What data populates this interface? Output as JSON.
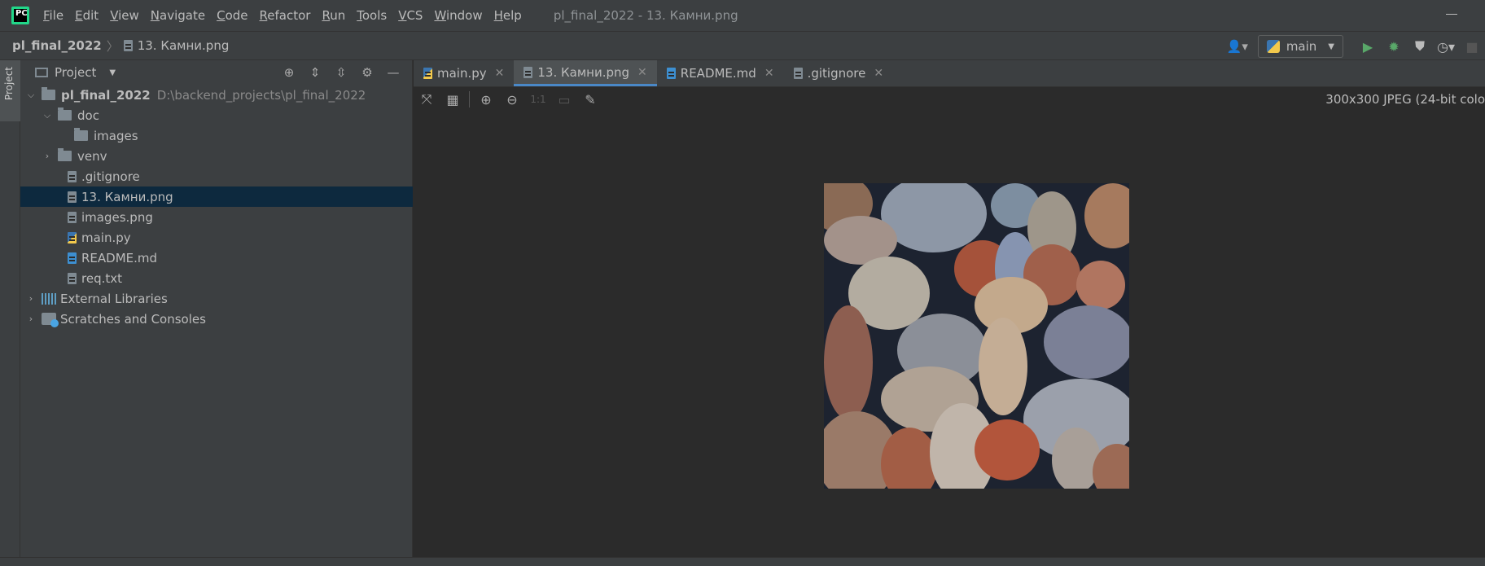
{
  "app": {
    "logo": "pycharm-logo",
    "logo_text": "PC",
    "window_title": "pl_final_2022 - 13. Камни.png"
  },
  "menu": [
    "File",
    "Edit",
    "View",
    "Navigate",
    "Code",
    "Refactor",
    "Run",
    "Tools",
    "VCS",
    "Window",
    "Help"
  ],
  "breadcrumb": {
    "project": "pl_final_2022",
    "file": "13. Камни.png"
  },
  "toolbar": {
    "run_config": "main",
    "icons": [
      "user-icon",
      "run-icon",
      "debug-icon",
      "coverage-icon",
      "profile-icon",
      "stop-icon"
    ]
  },
  "left_strip": {
    "project_label": "Project"
  },
  "project_panel": {
    "title": "Project",
    "tree": [
      {
        "label": "pl_final_2022",
        "path": "D:\\backend_projects\\pl_final_2022",
        "type": "folder",
        "expanded": true
      },
      {
        "label": "doc",
        "type": "folder",
        "expanded": true
      },
      {
        "label": "images",
        "type": "folder"
      },
      {
        "label": "venv",
        "type": "folder",
        "expanded": false
      },
      {
        "label": ".gitignore",
        "type": "file"
      },
      {
        "label": "13. Камни.png",
        "type": "file",
        "selected": true
      },
      {
        "label": "images.png",
        "type": "file"
      },
      {
        "label": "main.py",
        "type": "python"
      },
      {
        "label": "README.md",
        "type": "markdown"
      },
      {
        "label": "req.txt",
        "type": "file"
      },
      {
        "label": "External Libraries",
        "type": "libraries",
        "expanded": false
      },
      {
        "label": "Scratches and Consoles",
        "type": "scratches",
        "expanded": false
      }
    ]
  },
  "tabs": [
    {
      "label": "main.py",
      "active": false
    },
    {
      "label": "13. Камни.png",
      "active": true
    },
    {
      "label": "README.md",
      "active": false
    },
    {
      "label": ".gitignore",
      "active": false
    }
  ],
  "image_view": {
    "info": "300x300 JPEG (24-bit colo",
    "zoom_one_to_one": "1:1"
  },
  "colors": {
    "accent": "#4a88c7",
    "selection": "#0d293e",
    "run": "#59a869"
  }
}
